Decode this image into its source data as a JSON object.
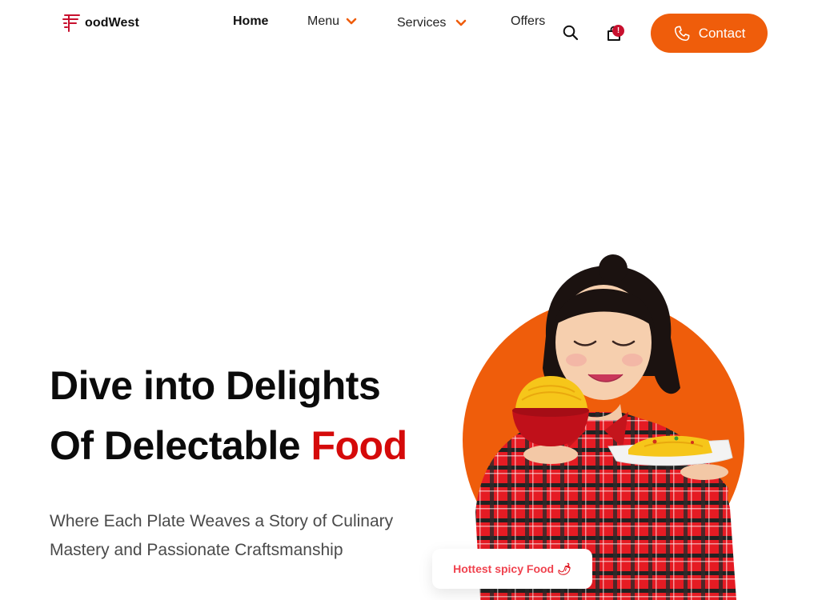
{
  "brand": {
    "name": "oodWest",
    "logo_letter": "F",
    "accent": "#c8102e"
  },
  "nav": {
    "items": [
      {
        "label": "Home",
        "dropdown": false
      },
      {
        "label": "Menu",
        "dropdown": true
      },
      {
        "label": "Services",
        "dropdown": true
      },
      {
        "label": "Offers",
        "dropdown": false
      }
    ],
    "cart_badge": "!",
    "contact_label": "Contact",
    "primary_color": "#ef5d0b"
  },
  "hero": {
    "title_line1": "Dive into Delights",
    "title_line2_prefix": "Of Delectable ",
    "title_line2_accent": "Food",
    "subtitle": "Where Each Plate Weaves a Story of Culinary Mastery and Passionate Craftsmanship",
    "badge": "Hottest spicy Food",
    "badge_emoji": "🌶",
    "title_accent_color": "#d50a0a"
  },
  "icons": [
    "logo-mark-icon",
    "chevron-down-icon",
    "search-icon",
    "shopping-bag-icon",
    "phone-icon",
    "chili-pepper-icon"
  ]
}
